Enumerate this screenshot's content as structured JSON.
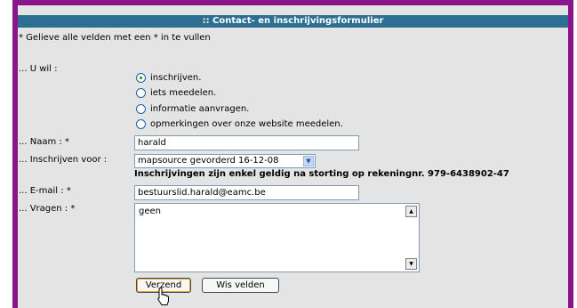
{
  "title": ":: Contact- en inschrijvingsformulier",
  "instruction": "* Gelieve alle velden met een * in te vullen",
  "wish": {
    "label": "... U wil :",
    "options": [
      "inschrijven.",
      "iets meedelen.",
      "informatie aanvragen.",
      "opmerkingen over onze website meedelen."
    ],
    "selected": 0
  },
  "name": {
    "label": "... Naam : *",
    "value": "harald"
  },
  "registration": {
    "label": "... Inschrijven voor :",
    "selected": "mapsource gevorderd 16-12-08",
    "note": "Inschrijvingen zijn enkel geldig na storting op rekeningnr. 979-6438902-47"
  },
  "email": {
    "label": "... E-mail : *",
    "value": "bestuurslid.harald@eamc.be"
  },
  "questions": {
    "label": "... Vragen : *",
    "value": "geen"
  },
  "buttons": {
    "submit": "Verzend",
    "reset": "Wis velden"
  },
  "colors": {
    "border": "#8a148a",
    "titlebar": "#2c6f92",
    "panel": "#e4e4e4"
  }
}
